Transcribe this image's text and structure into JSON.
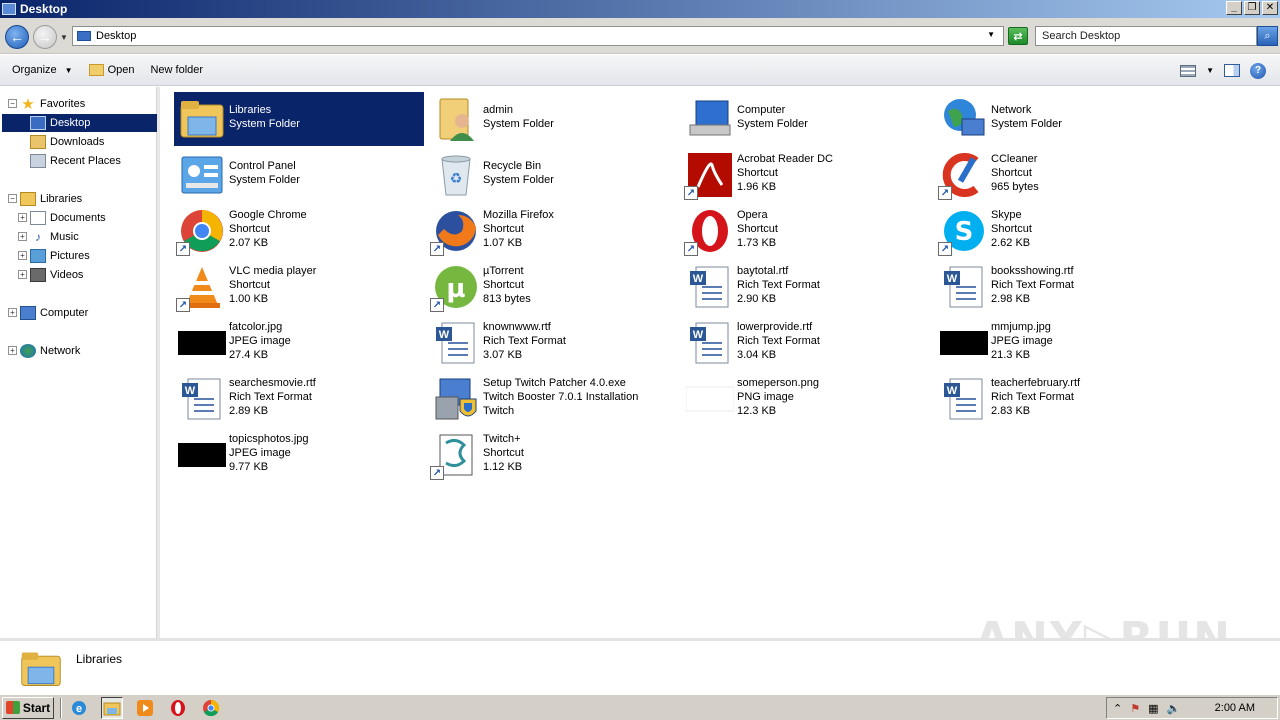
{
  "window": {
    "title": "Desktop",
    "minimize": "_",
    "restore": "❐",
    "close": "✕"
  },
  "address": {
    "path": "Desktop",
    "search_placeholder": "Search Desktop"
  },
  "toolbar": {
    "organize": "Organize",
    "open": "Open",
    "new_folder": "New folder"
  },
  "nav": {
    "favorites": "Favorites",
    "desktop": "Desktop",
    "downloads": "Downloads",
    "recent": "Recent Places",
    "libraries": "Libraries",
    "documents": "Documents",
    "music": "Music",
    "pictures": "Pictures",
    "videos": "Videos",
    "computer": "Computer",
    "network": "Network"
  },
  "items": [
    {
      "name": "Libraries",
      "l2": "System Folder",
      "l3": ""
    },
    {
      "name": "admin",
      "l2": "System Folder",
      "l3": ""
    },
    {
      "name": "Computer",
      "l2": "System Folder",
      "l3": ""
    },
    {
      "name": "Network",
      "l2": "System Folder",
      "l3": ""
    },
    {
      "name": "Control Panel",
      "l2": "System Folder",
      "l3": ""
    },
    {
      "name": "Recycle Bin",
      "l2": "System Folder",
      "l3": ""
    },
    {
      "name": "Acrobat Reader DC",
      "l2": "Shortcut",
      "l3": "1.96 KB"
    },
    {
      "name": "CCleaner",
      "l2": "Shortcut",
      "l3": "965 bytes"
    },
    {
      "name": "Google Chrome",
      "l2": "Shortcut",
      "l3": "2.07 KB"
    },
    {
      "name": "Mozilla Firefox",
      "l2": "Shortcut",
      "l3": "1.07 KB"
    },
    {
      "name": "Opera",
      "l2": "Shortcut",
      "l3": "1.73 KB"
    },
    {
      "name": "Skype",
      "l2": "Shortcut",
      "l3": "2.62 KB"
    },
    {
      "name": "VLC media player",
      "l2": "Shortcut",
      "l3": "1.00 KB"
    },
    {
      "name": "µTorrent",
      "l2": "Shortcut",
      "l3": "813 bytes"
    },
    {
      "name": "baytotal.rtf",
      "l2": "Rich Text Format",
      "l3": "2.90 KB"
    },
    {
      "name": "booksshowing.rtf",
      "l2": "Rich Text Format",
      "l3": "2.98 KB"
    },
    {
      "name": "fatcolor.jpg",
      "l2": "JPEG image",
      "l3": "27.4 KB"
    },
    {
      "name": "knownwww.rtf",
      "l2": "Rich Text Format",
      "l3": "3.07 KB"
    },
    {
      "name": "lowerprovide.rtf",
      "l2": "Rich Text Format",
      "l3": "3.04 KB"
    },
    {
      "name": "mmjump.jpg",
      "l2": "JPEG image",
      "l3": "21.3 KB"
    },
    {
      "name": "searchesmovie.rtf",
      "l2": "Rich Text Format",
      "l3": "2.89 KB"
    },
    {
      "name": "Setup Twitch Patcher 4.0.exe",
      "l2": "Twitch Booster 7.0.1 Installation",
      "l3": "Twitch"
    },
    {
      "name": "someperson.png",
      "l2": "PNG image",
      "l3": "12.3 KB"
    },
    {
      "name": "teacherfebruary.rtf",
      "l2": "Rich Text Format",
      "l3": "2.83 KB"
    },
    {
      "name": "topicsphotos.jpg",
      "l2": "JPEG image",
      "l3": "9.77 KB"
    },
    {
      "name": "Twitch+",
      "l2": "Shortcut",
      "l3": "1.12 KB"
    }
  ],
  "details": {
    "name": "Libraries"
  },
  "watermark": "ANY▷RUN",
  "taskbar": {
    "start": "Start",
    "clock": "2:00 AM"
  },
  "colors": {
    "selection": "#0a246a",
    "title_start": "#0a246a",
    "title_end": "#a6caf0"
  }
}
